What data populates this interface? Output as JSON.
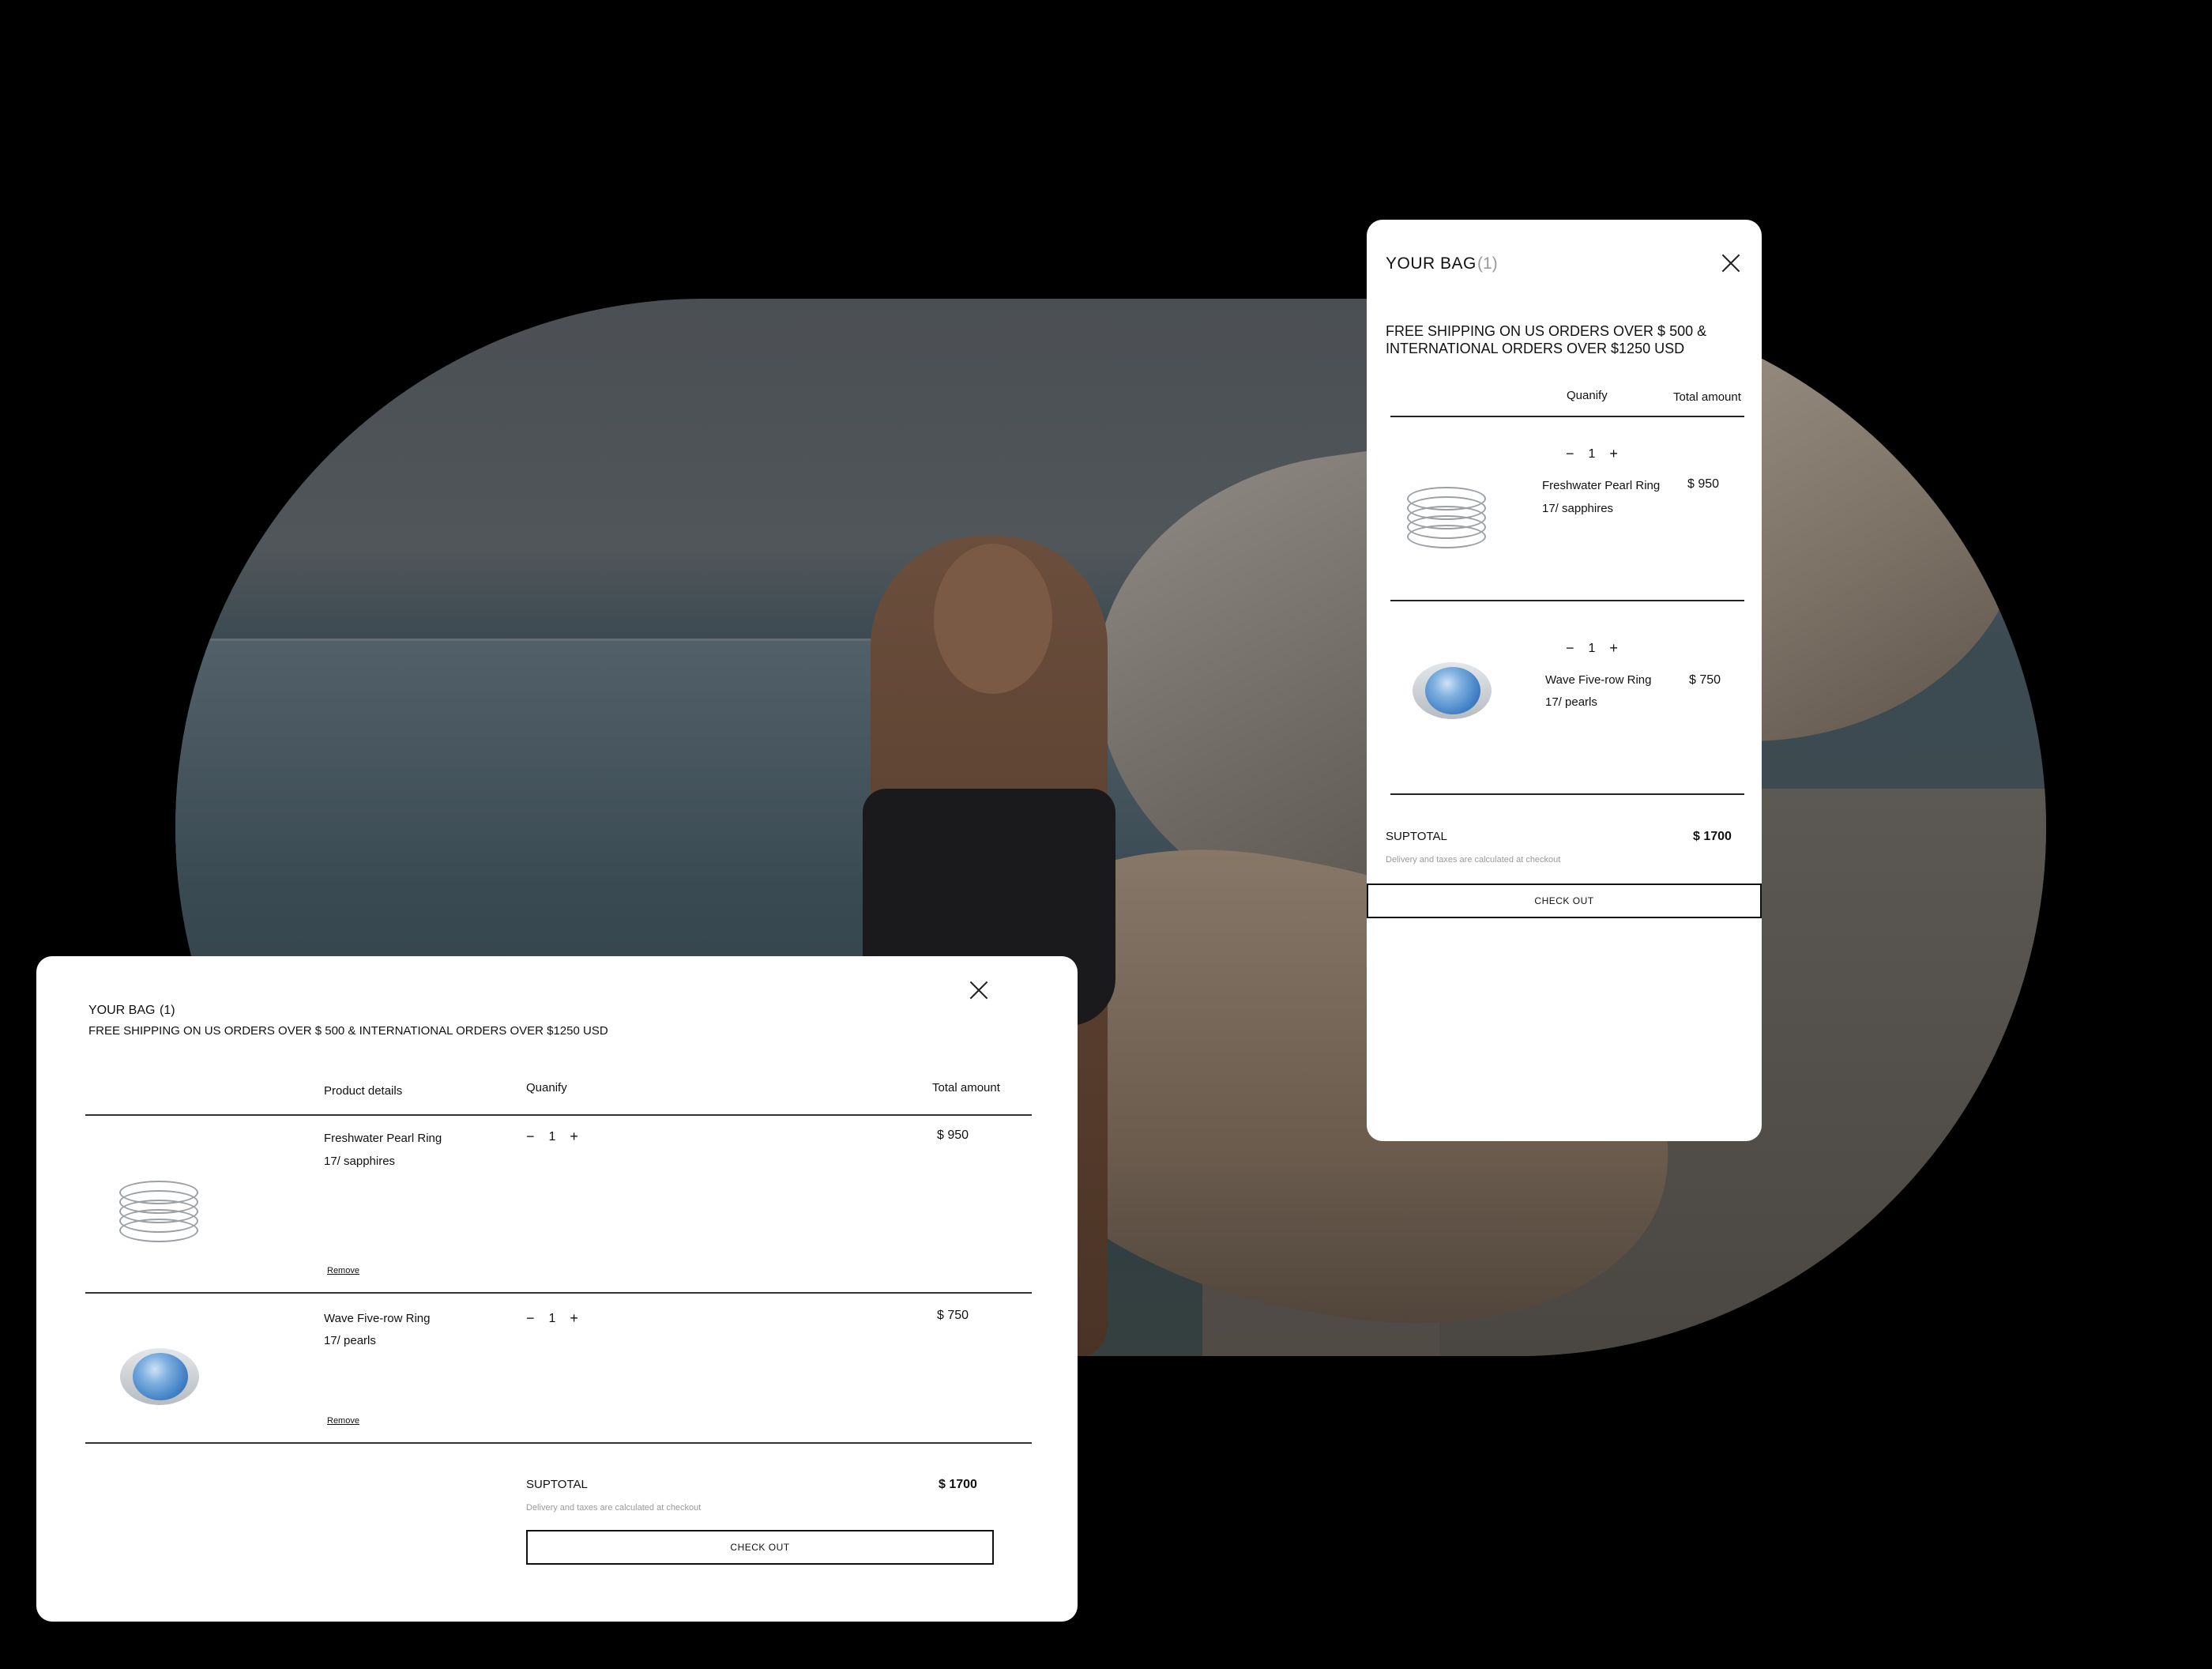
{
  "cart_mobile": {
    "title": "YOUR BAG",
    "count": "(1)",
    "shipping_notice": "FREE SHIPPING ON US ORDERS OVER $ 500 & INTERNATIONAL ORDERS OVER $1250 USD",
    "col_quantity": "Quanify",
    "col_total": "Total amount",
    "items": [
      {
        "name": "Freshwater Pearl Ring",
        "variant": "17/ sapphires",
        "qty": "1",
        "minus": "−",
        "plus": "+",
        "price": "$ 950"
      },
      {
        "name": "Wave Five-row Ring",
        "variant": "17/ pearls",
        "qty": "1",
        "minus": "−",
        "plus": "+",
        "price": "$ 750"
      }
    ],
    "subtotal_label": "SUPTOTAL",
    "subtotal_value": "$ 1700",
    "note": "Delivery and taxes are calculated at checkout",
    "checkout_label": "CHECK OUT"
  },
  "cart_desktop": {
    "title": "YOUR BAG",
    "count": "(1)",
    "shipping_notice": "FREE SHIPPING ON US ORDERS OVER $ 500 & INTERNATIONAL ORDERS OVER $1250 USD",
    "col_product": "Product details",
    "col_quantity": "Quanify",
    "col_total": "Total amount",
    "items": [
      {
        "name": "Freshwater Pearl Ring",
        "variant": "17/ sapphires",
        "qty": "1",
        "minus": "−",
        "plus": "+",
        "price": "$ 950",
        "remove_label": "Remove"
      },
      {
        "name": "Wave Five-row Ring",
        "variant": "17/ pearls",
        "qty": "1",
        "minus": "−",
        "plus": "+",
        "price": "$ 750",
        "remove_label": "Remove"
      }
    ],
    "subtotal_label": "SUPTOTAL",
    "subtotal_value": "$ 1700",
    "note": "Delivery and taxes are calculated at checkout",
    "checkout_label": "CHECK OUT"
  },
  "colors": {
    "background": "#000000",
    "panel": "#ffffff",
    "text": "#111111",
    "muted": "#9a9a9a",
    "gem_blue": "#3f7fc4"
  }
}
